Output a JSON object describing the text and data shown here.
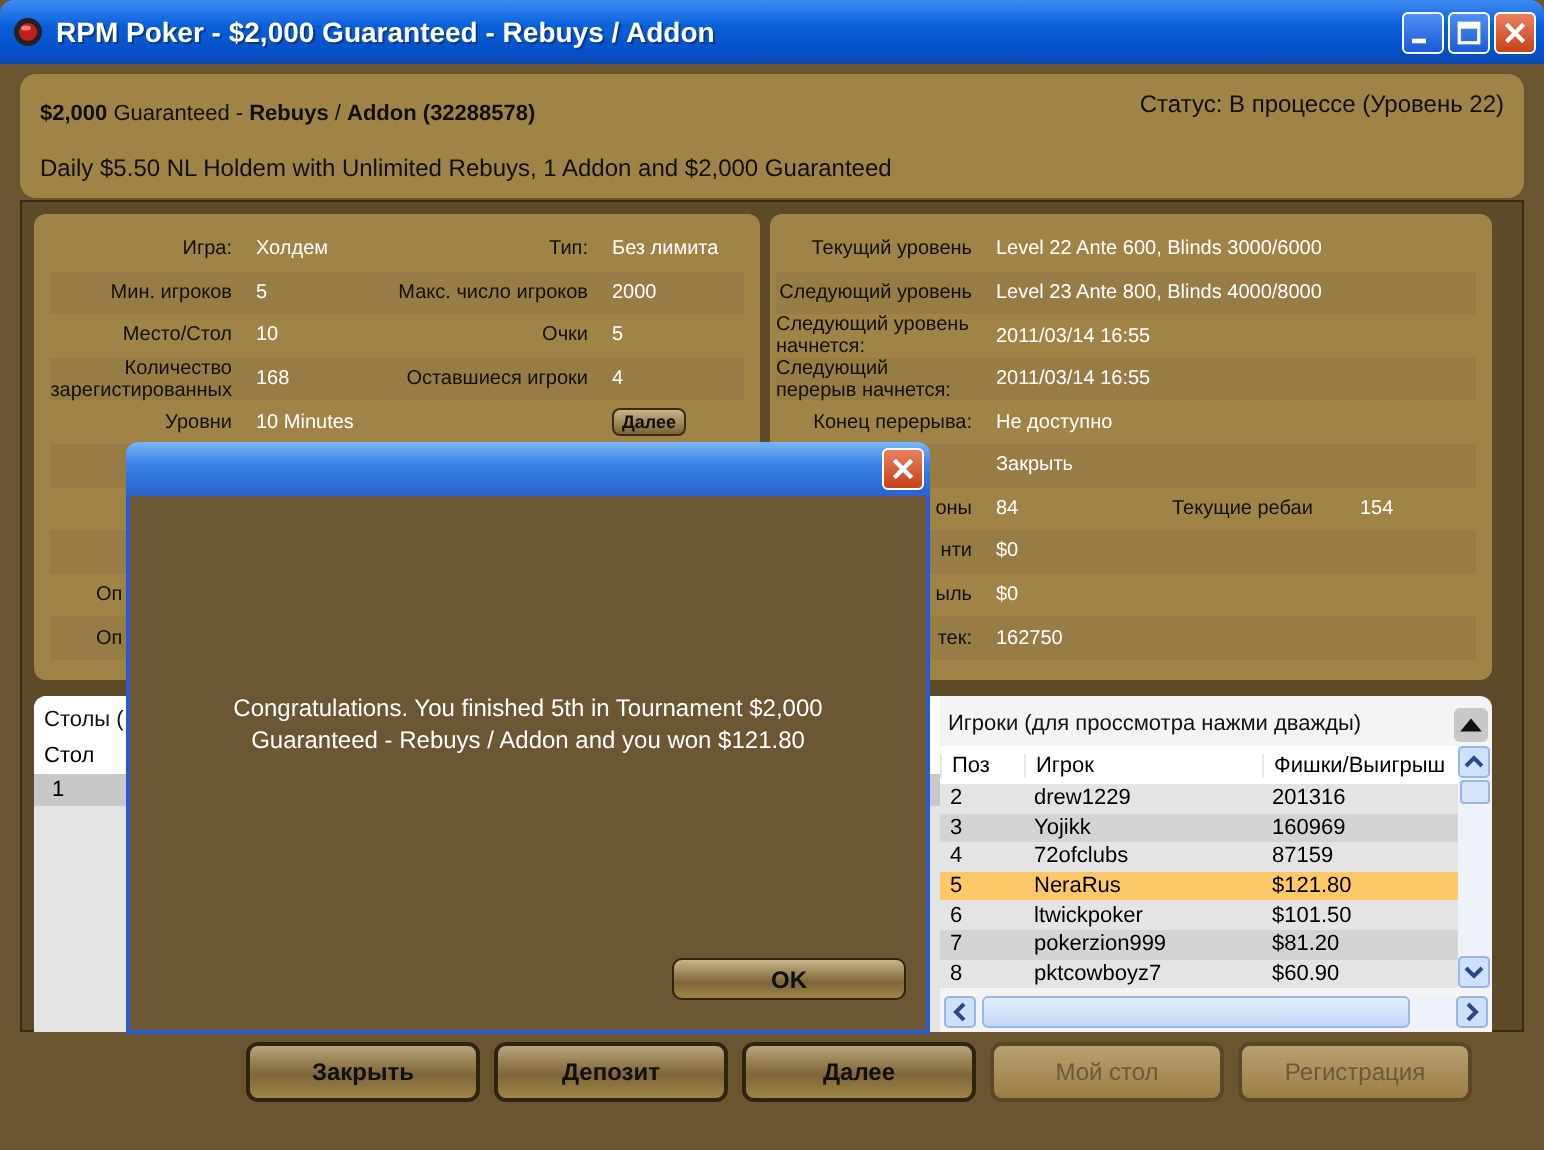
{
  "window": {
    "title": "RPM Poker - $2,000 Guaranteed - Rebuys / Addon"
  },
  "header": {
    "title": "**$2,000** Guaranteed - **Rebuys** / **Addon** **(32288578)**",
    "status": "Статус: В процессе (Уровень 22)",
    "description": "Daily $5.50 NL Holdem with Unlimited Rebuys, 1 Addon and $2,000 Guaranteed"
  },
  "game_info": [
    {
      "label": "Игра:",
      "value": "Холдем",
      "label_2": "Тип:",
      "value_2": "Без лимита"
    },
    {
      "label": "Мин. игроков",
      "value": "5",
      "label_2": "Макс. число игроков",
      "value_2": "2000"
    },
    {
      "label": "Место/Стол",
      "value": "10",
      "label_2": "Очки",
      "value_2": "5"
    },
    {
      "label": "Количество зарегистированных",
      "value": "168",
      "label_2": "Оставшиеся игроки",
      "value_2": "4"
    },
    {
      "label": "Уровни",
      "value": "10 Minutes",
      "button": "Далее"
    }
  ],
  "game_info_bottom": [
    {
      "label": "Оп"
    },
    {
      "label": "Оп"
    }
  ],
  "level_info": [
    {
      "label": "Текущий уровень",
      "value": "Level 22 Ante 600, Blinds 3000/6000"
    },
    {
      "label": "Следующий уровень",
      "value": "Level 23 Ante 800, Blinds 4000/8000"
    },
    {
      "label": "Следующий уровень начнется:",
      "value": "2011/03/14 16:55"
    },
    {
      "label": "Следующий перерыв начнется:",
      "value": "2011/03/14 16:55"
    },
    {
      "label": "Конец перерыва:",
      "value": "Не доступно"
    },
    {
      "value": "Закрыть"
    },
    {
      "label": "оны",
      "value": "84",
      "label_2": "Текущие ребаи",
      "value_2": "154"
    },
    {
      "label": "нти",
      "value": "$0"
    },
    {
      "label": "ыль",
      "value": "$0"
    },
    {
      "label": "тек:",
      "value": "162750"
    }
  ],
  "tables": {
    "title": "Столы (",
    "columns": [
      "Стол"
    ],
    "rows": [
      [
        "1"
      ]
    ]
  },
  "players": {
    "title": "Игроки (для проссмотра нажми дважды)",
    "columns": [
      "Поз",
      "Игрок",
      "Фишки/Выигрыш"
    ],
    "rows": [
      {
        "cells": [
          "2",
          "drew1229",
          "201316"
        ],
        "selected": false
      },
      {
        "cells": [
          "3",
          "Yojikk",
          "160969"
        ],
        "selected": false
      },
      {
        "cells": [
          "4",
          "72ofclubs",
          "87159"
        ],
        "selected": false
      },
      {
        "cells": [
          "5",
          "NeraRus",
          "$121.80"
        ],
        "selected": true
      },
      {
        "cells": [
          "6",
          "ltwickpoker",
          "$101.50"
        ],
        "selected": false
      },
      {
        "cells": [
          "7",
          "pokerzion999",
          "$81.20"
        ],
        "selected": false
      },
      {
        "cells": [
          "8",
          "pktcowboyz7",
          "$60.90"
        ],
        "selected": false
      }
    ]
  },
  "buttons": [
    {
      "label": "Закрыть",
      "disabled": false
    },
    {
      "label": "Депозит",
      "disabled": false
    },
    {
      "label": "Далее",
      "disabled": false
    },
    {
      "label": "Мой стол",
      "disabled": true
    },
    {
      "label": "Регистрация",
      "disabled": true
    }
  ],
  "dialog": {
    "message": "Congratulations. You finished 5th in Tournament $2,000 Guaranteed - Rebuys / Addon and you won $121.80",
    "ok": "OK"
  }
}
